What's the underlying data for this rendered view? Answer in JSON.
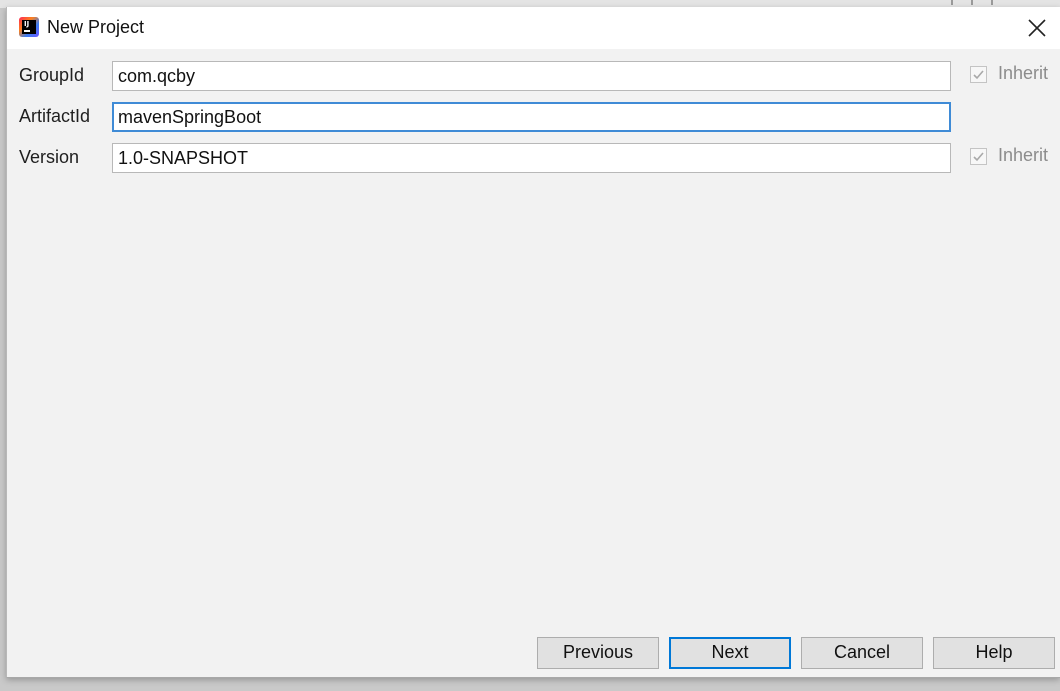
{
  "window": {
    "title": "New Project",
    "icon": "intellij-idea-icon",
    "app_icon_text": "IJ"
  },
  "form": {
    "group_id": {
      "label": "GroupId",
      "value": "com.qcby",
      "inherit_label": "Inherit",
      "inherit_checked": true
    },
    "artifact_id": {
      "label": "ArtifactId",
      "value": "mavenSpringBoot"
    },
    "version": {
      "label": "Version",
      "value": "1.0-SNAPSHOT",
      "inherit_label": "Inherit",
      "inherit_checked": true
    }
  },
  "buttons": {
    "previous": "Previous",
    "next": "Next",
    "cancel": "Cancel",
    "help": "Help"
  },
  "colors": {
    "focus_border": "#3f8bd6",
    "default_button_border": "#0078d7",
    "dialog_background": "#f2f2f2"
  }
}
